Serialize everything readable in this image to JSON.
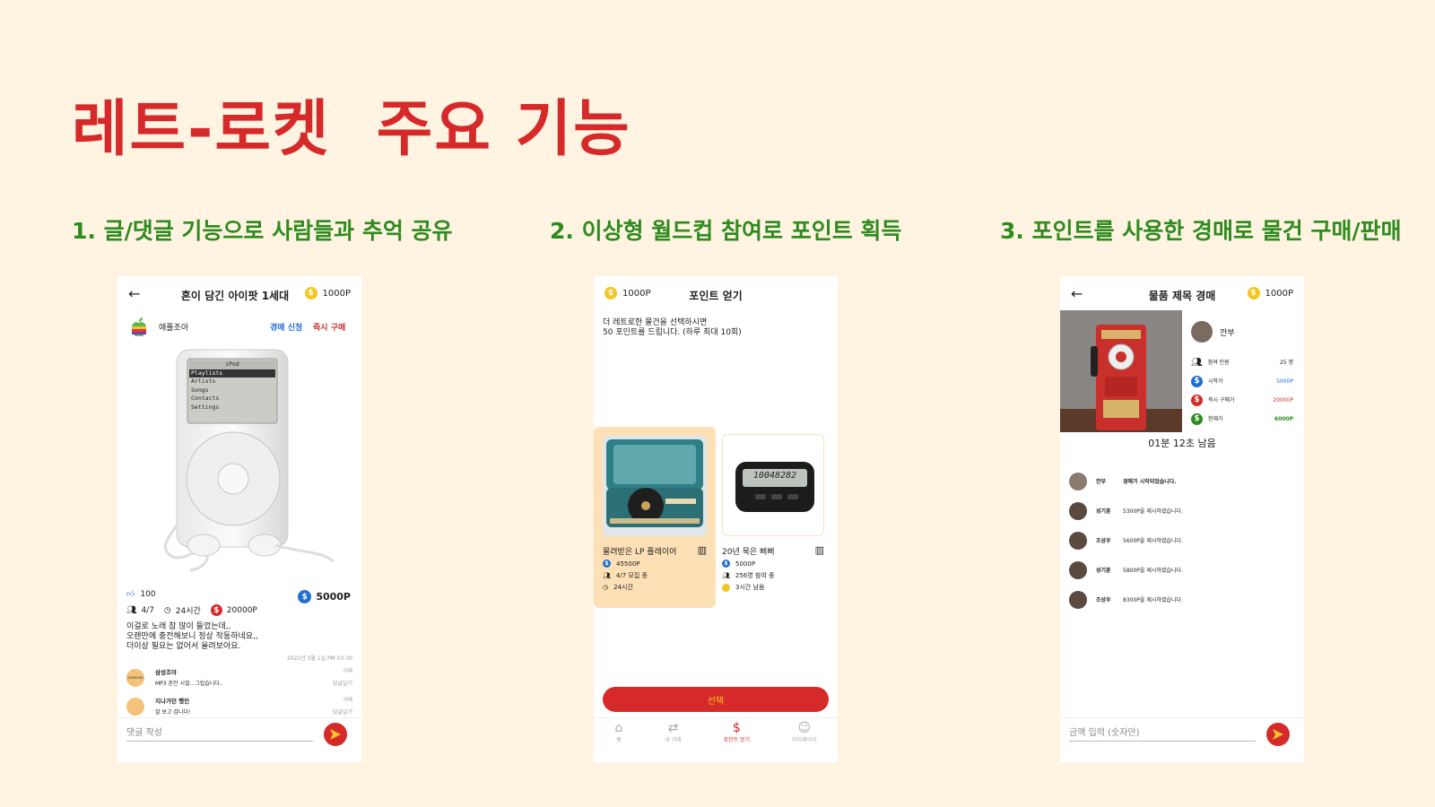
{
  "title": "레트-로켓  주요 기능",
  "features": [
    "1. 글/댓글 기능으로 사람들과 추억 공유",
    "2. 이상형 월드컵 참여로 포인트 획득",
    "3. 포인트를 사용한 경매로 물건 구매/판매"
  ],
  "phone1": {
    "title": "혼이 담긴 아이팟 1세대",
    "points": "1000P",
    "seller": "애플조아",
    "auction_btn": "경매 신청",
    "buy_btn": "즉시 구매",
    "ipod_menu_title": "iPod",
    "ipod_menu": [
      "Playlists",
      "Artists",
      "Songs",
      "Contacts",
      "Settings"
    ],
    "likes": "100",
    "participants": "4/7",
    "time": "24시간",
    "instant_price": "20000P",
    "current_price": "5000P",
    "body": [
      "이걸로 노래 참 많이 들었는데,,",
      "오랜만에 충전해보니 정상 작동하네요,,",
      "더이상 필요는 없어서 올려보아요."
    ],
    "date": "2022년 3월 1일 PM 03:30",
    "comments": [
      {
        "name": "삼성조아",
        "text": "MP3 혼안 시절.. 그립습니다..",
        "when": "어제",
        "reply": "답글달기",
        "avatar_text": "SAMSUNG"
      },
      {
        "name": "지나가던 행인",
        "text": "잘 보고 갑니다!",
        "when": "어제",
        "reply": "답글달기",
        "avatar_text": ""
      }
    ],
    "comment_placeholder": "댓글 작성"
  },
  "phone2": {
    "points": "1000P",
    "title": "포인트 얻기",
    "desc": [
      "더 레트로한 물건을 선택하시면",
      "50 포인트를 드립니다. (하루 최대 10회)"
    ],
    "items": [
      {
        "name": "물려받은 LP 플레이어",
        "price": "45500P",
        "people": "4/7 모집 중",
        "time": "24시간"
      },
      {
        "name": "20년 묵은 삐삐",
        "price": "5000P",
        "people": "256명 참여 중",
        "time": "3시간 남음"
      }
    ],
    "pager_display": "10048282",
    "select_btn": "선택",
    "nav": [
      "홈",
      "내 거래",
      "포인트 얻기",
      "마이페이지"
    ]
  },
  "phone3": {
    "title": "물품 제목 경매",
    "points": "1000P",
    "seller": "깐부",
    "stats": [
      {
        "label": "참여 인원",
        "value": "25 명"
      },
      {
        "label": "시작가",
        "value": "5000P"
      },
      {
        "label": "즉시 구매가",
        "value": "20000P"
      },
      {
        "label": "현재가",
        "value": "6000P"
      }
    ],
    "countdown": "01분 12초 남음",
    "bids": [
      {
        "name": "깐부",
        "text": "경매가 시작되었습니다."
      },
      {
        "name": "성기훈",
        "text": "5300P을 제시하였습니다."
      },
      {
        "name": "조상우",
        "text": "5600P을 제시하였습니다."
      },
      {
        "name": "성기훈",
        "text": "5800P을 제시하였습니다."
      },
      {
        "name": "조상우",
        "text": "8300P을 제시하였습니다."
      }
    ],
    "bid_placeholder": "금액 입력 (숫자만)"
  }
}
